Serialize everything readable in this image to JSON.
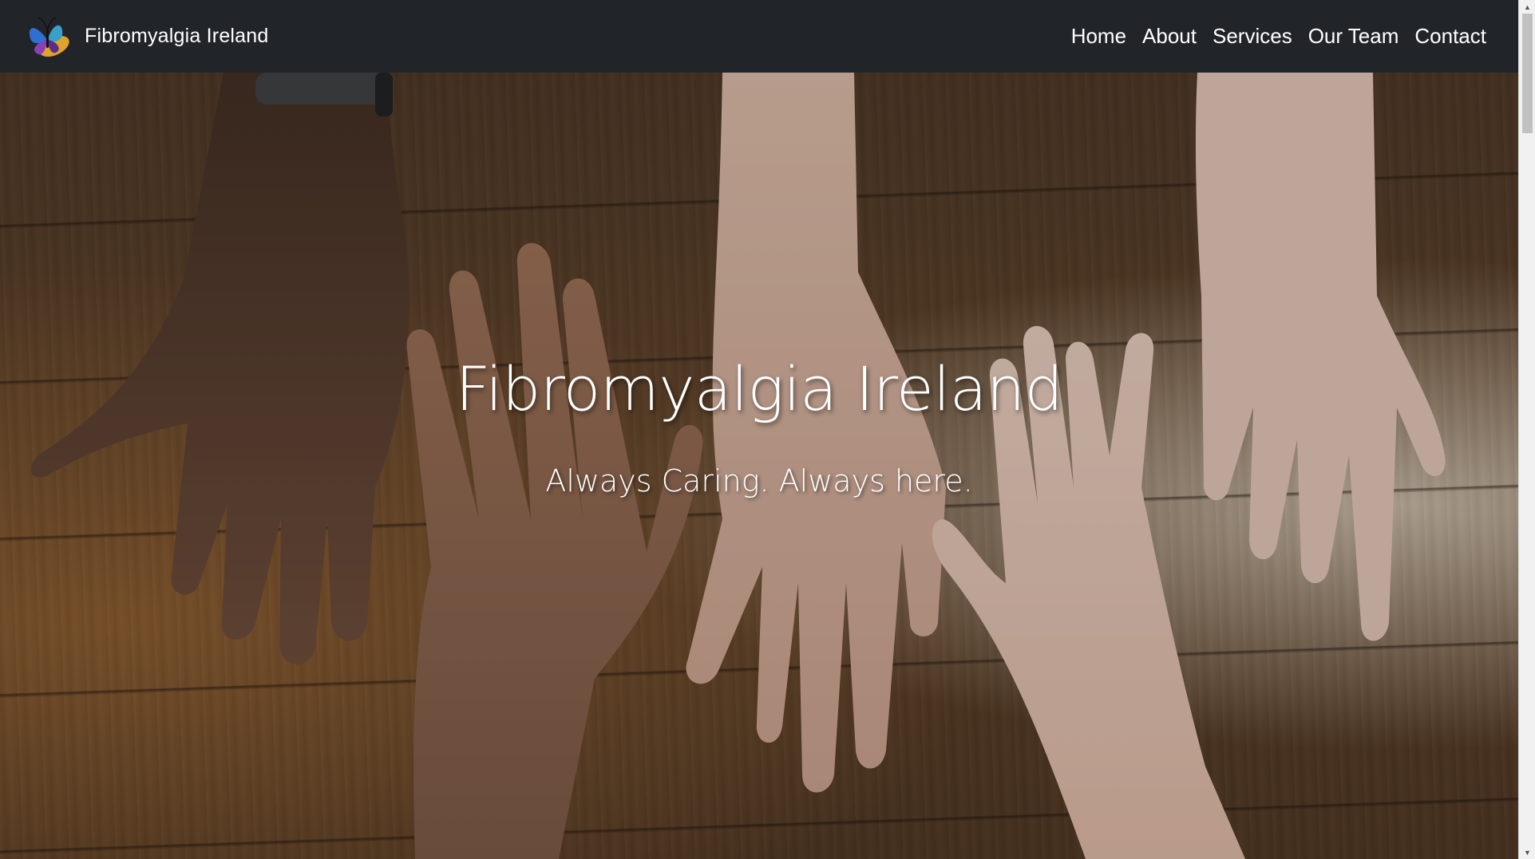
{
  "navbar": {
    "brand_name": "Fibromyalgia Ireland",
    "logo_icon": "butterfly-logo-icon",
    "links": [
      {
        "label": "Home"
      },
      {
        "label": "About"
      },
      {
        "label": "Services"
      },
      {
        "label": "Our Team"
      },
      {
        "label": "Contact"
      }
    ]
  },
  "hero": {
    "title": "Fibromyalgia Ireland",
    "tagline": "Always Caring. Always here.",
    "background_image": "hands-on-wooden-table-photo"
  },
  "colors": {
    "navbar_bg": "#212529",
    "nav_text": "#ffffff",
    "hero_text": "#ffffff"
  }
}
